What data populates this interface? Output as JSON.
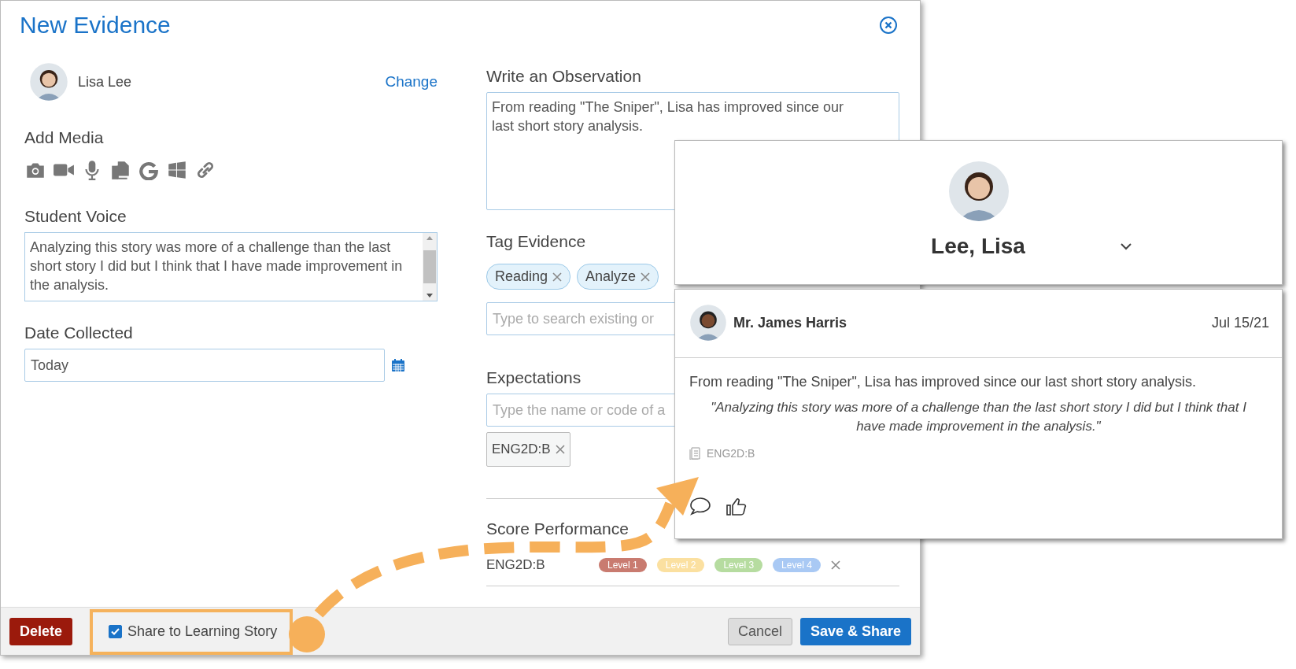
{
  "dialog": {
    "title": "New Evidence",
    "student": {
      "name": "Lisa Lee",
      "change_link": "Change"
    },
    "add_media": {
      "label": "Add Media"
    },
    "student_voice": {
      "label": "Student Voice",
      "value": "Analyzing this story was more of a challenge than the last short story I did but I think that I have made improvement in the analysis."
    },
    "date_collected": {
      "label": "Date Collected",
      "value": "Today"
    },
    "observation": {
      "label": "Write an Observation",
      "value": "From reading \"The Sniper\", Lisa has improved since our last short story analysis."
    },
    "tag_evidence": {
      "label": "Tag Evidence",
      "tags": [
        "Reading",
        "Analyze"
      ],
      "search": {
        "placeholder": "Type to search existing or"
      }
    },
    "expectations": {
      "label": "Expectations",
      "search": {
        "placeholder": "Type the name or code of a"
      },
      "chips": [
        "ENG2D:B"
      ]
    },
    "score_performance": {
      "label": "Score Performance",
      "rows": [
        {
          "code": "ENG2D:B",
          "levels": [
            {
              "label": "Level 1",
              "color": "#c97b70"
            },
            {
              "label": "Level 2",
              "color": "#fbe0a0"
            },
            {
              "label": "Level 3",
              "color": "#b6dca0"
            },
            {
              "label": "Level 4",
              "color": "#a9c9f4"
            }
          ]
        }
      ]
    },
    "footer": {
      "delete": "Delete",
      "share": {
        "label": "Share to Learning Story",
        "checked": true
      },
      "cancel": "Cancel",
      "save": "Save & Share"
    }
  },
  "student_card": {
    "name": "Lee, Lisa"
  },
  "post_card": {
    "author": "Mr. James Harris",
    "date": "Jul 15/21",
    "observation": "From reading \"The Sniper\", Lisa has improved since our last short story analysis.",
    "quote": "\"Analyzing this story was more of a challenge than the last short story I did but I think that I have made improvement in the analysis.\"",
    "expectation": "ENG2D:B"
  }
}
